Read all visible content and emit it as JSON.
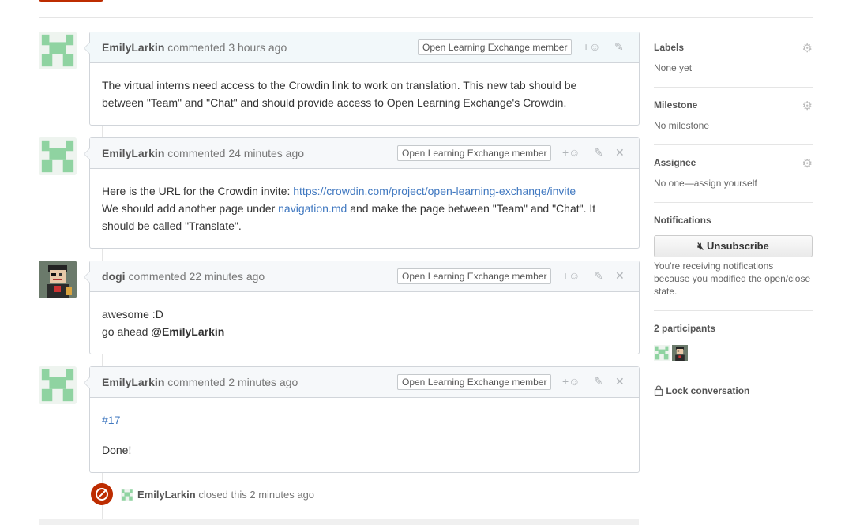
{
  "comments": [
    {
      "author": "EmilyLarkin",
      "action": "commented",
      "time": "3 hours ago",
      "badge": "Open Learning Exchange member",
      "body_line1": "The virtual interns need access to the Crowdin link to work on translation. This new tab should be",
      "body_line2": "between \"Team\" and \"Chat\" and should provide access to Open Learning Exchange's Crowdin."
    },
    {
      "author": "EmilyLarkin",
      "action": "commented",
      "time": "24 minutes ago",
      "badge": "Open Learning Exchange member",
      "line1_text": "Here is the URL for the Crowdin invite: ",
      "line1_link": "https://crowdin.com/project/open-learning-exchange/invite",
      "line2_pre": "We should add another page under ",
      "line2_link": "navigation.md",
      "line2_post": " and make the page between \"Team\" and \"Chat\". It",
      "line3": "should be called \"Translate\"."
    },
    {
      "author": "dogi",
      "action": "commented",
      "time": "22 minutes ago",
      "badge": "Open Learning Exchange member",
      "line1": "awesome :D",
      "line2_pre": "go ahead ",
      "line2_mention": "@EmilyLarkin"
    },
    {
      "author": "EmilyLarkin",
      "action": "commented",
      "time": "2 minutes ago",
      "badge": "Open Learning Exchange member",
      "issue_link": "#17",
      "line2": "Done!"
    }
  ],
  "actions": {
    "reaction": "+☺",
    "edit": "✎",
    "delete": "✕"
  },
  "closed_event": {
    "author": "EmilyLarkin",
    "text": "closed this 2 minutes ago"
  },
  "sidebar": {
    "labels": {
      "title": "Labels",
      "value": "None yet"
    },
    "milestone": {
      "title": "Milestone",
      "value": "No milestone"
    },
    "assignee": {
      "title": "Assignee",
      "value": "No one—assign yourself"
    },
    "notifications": {
      "title": "Notifications",
      "button": "Unsubscribe",
      "desc1": "You're receiving notifications",
      "desc2": "because you modified the open/close",
      "desc3": "state."
    },
    "participants": {
      "title": "2 participants"
    },
    "lock": {
      "label": "Lock conversation"
    }
  },
  "colors": {
    "link": "#4078c0",
    "closed": "#bd2c00",
    "identicon": "#8fd3a1"
  },
  "icons": {
    "gear": "gear-icon",
    "mute": "mute-icon",
    "lock": "lock-icon",
    "closed": "circle-slash-icon"
  }
}
